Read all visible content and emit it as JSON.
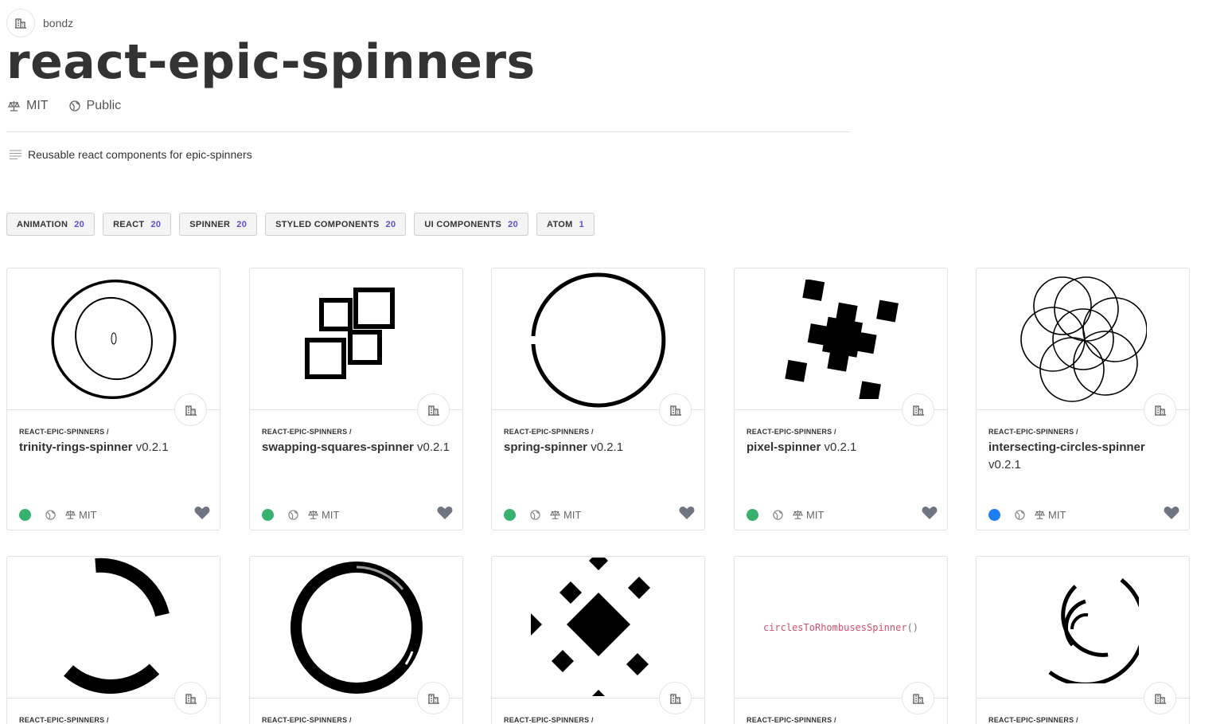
{
  "header": {
    "owner": "bondz",
    "title": "react-epic-spinners",
    "license": "MIT",
    "visibility": "Public",
    "description": "Reusable react components for epic-spinners"
  },
  "tags": [
    {
      "label": "ANIMATION",
      "count": "20"
    },
    {
      "label": "REACT",
      "count": "20"
    },
    {
      "label": "SPINNER",
      "count": "20"
    },
    {
      "label": "STYLED COMPONENTS",
      "count": "20"
    },
    {
      "label": "UI COMPONENTS",
      "count": "20"
    },
    {
      "label": "ATOM",
      "count": "1"
    }
  ],
  "cards": [
    {
      "scope": "REACT-EPIC-SPINNERS /",
      "name": "trinity-rings-spinner",
      "version": "v0.2.1",
      "license": "MIT",
      "status_color": "#37b26c",
      "preview": "trinity-rings-icon"
    },
    {
      "scope": "REACT-EPIC-SPINNERS /",
      "name": "swapping-squares-spinner",
      "version": "v0.2.1",
      "license": "MIT",
      "status_color": "#37b26c",
      "preview": "swapping-squares-icon"
    },
    {
      "scope": "REACT-EPIC-SPINNERS /",
      "name": "spring-spinner",
      "version": "v0.2.1",
      "license": "MIT",
      "status_color": "#37b26c",
      "preview": "spring-icon"
    },
    {
      "scope": "REACT-EPIC-SPINNERS /",
      "name": "pixel-spinner",
      "version": "v0.2.1",
      "license": "MIT",
      "status_color": "#37b26c",
      "preview": "pixel-icon"
    },
    {
      "scope": "REACT-EPIC-SPINNERS /",
      "name": "intersecting-circles-spinner",
      "version": "v0.2.1",
      "license": "MIT",
      "status_color": "#1c7ef0",
      "preview": "intersecting-circles-icon"
    },
    {
      "scope": "REACT-EPIC-SPINNERS /",
      "preview": "half-circle-icon"
    },
    {
      "scope": "REACT-EPIC-SPINNERS /",
      "preview": "ring-icon"
    },
    {
      "scope": "REACT-EPIC-SPINNERS /",
      "preview": "diamonds-icon"
    },
    {
      "scope": "REACT-EPIC-SPINNERS /",
      "preview_text": "circlesToRhombusesSpinner",
      "preview_suffix": "()"
    },
    {
      "scope": "REACT-EPIC-SPINNERS /",
      "preview": "arcs-icon"
    }
  ]
}
